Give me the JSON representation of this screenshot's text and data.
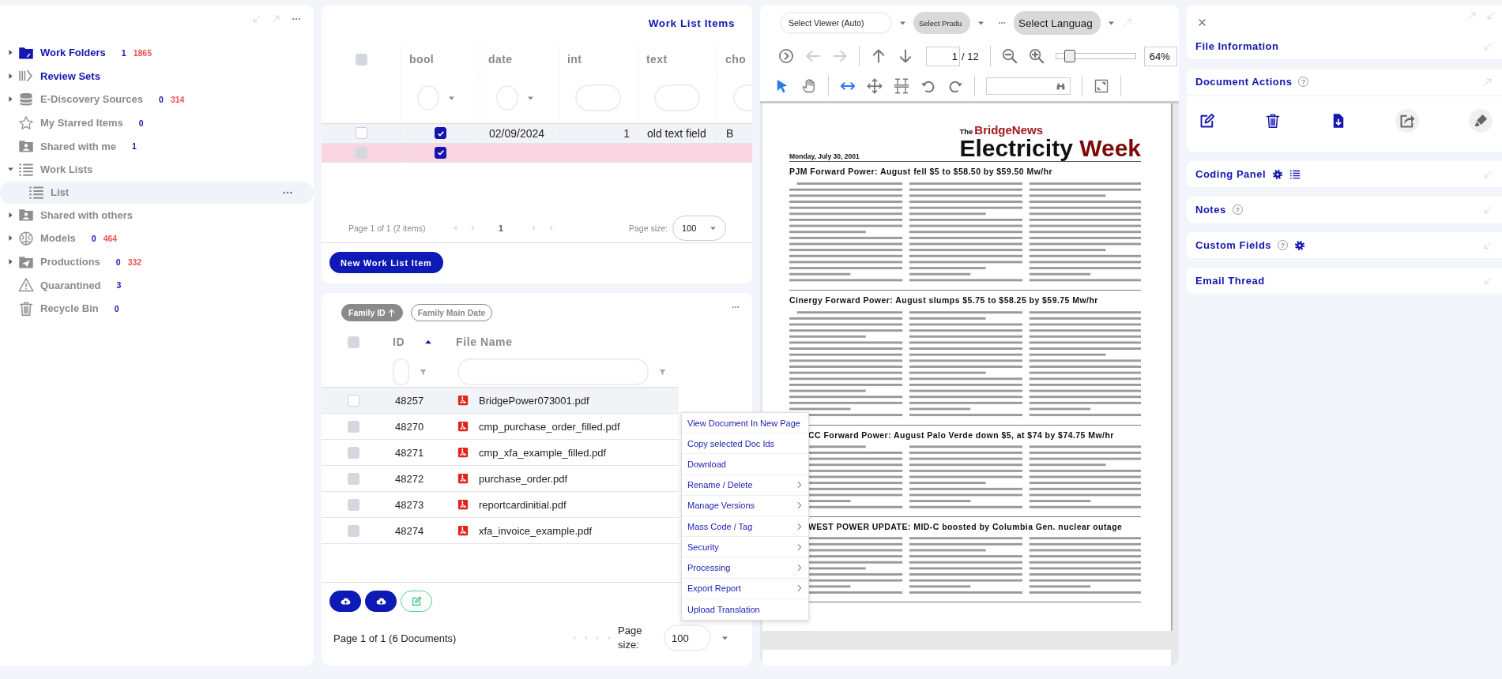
{
  "sidebar": {
    "items": [
      {
        "label": "Work Folders",
        "has_children": true,
        "expanded": false,
        "highlighted": true,
        "count": "1",
        "total": "1865"
      },
      {
        "label": "Review Sets",
        "has_children": true,
        "expanded": false,
        "highlighted": true
      },
      {
        "label": "E-Discovery Sources",
        "has_children": true,
        "expanded": false,
        "highlighted": false,
        "count": "0",
        "total": "314"
      },
      {
        "label": "My Starred Items",
        "has_children": false,
        "highlighted": false,
        "count": "0"
      },
      {
        "label": "Shared with me",
        "has_children": false,
        "highlighted": false,
        "count": "1"
      },
      {
        "label": "Work Lists",
        "has_children": true,
        "expanded": true,
        "highlighted": false,
        "children": [
          {
            "label": "List",
            "selected": true
          }
        ]
      },
      {
        "label": "Shared with others",
        "has_children": true,
        "expanded": false,
        "highlighted": false
      },
      {
        "label": "Models",
        "has_children": true,
        "expanded": false,
        "highlighted": false,
        "count": "0",
        "total": "464"
      },
      {
        "label": "Productions",
        "has_children": true,
        "expanded": false,
        "highlighted": false,
        "count": "0",
        "total": "332"
      },
      {
        "label": "Quarantined",
        "has_children": false,
        "highlighted": false,
        "count": "3"
      },
      {
        "label": "Recycle Bin",
        "has_children": false,
        "highlighted": false,
        "count": "0"
      }
    ]
  },
  "work_list": {
    "title": "Work List Items",
    "all_selected": false,
    "columns": [
      {
        "label": "bool",
        "kind": "dropdown"
      },
      {
        "label": "date",
        "kind": "dropdown"
      },
      {
        "label": "int",
        "kind": "text"
      },
      {
        "label": "text",
        "kind": "text"
      },
      {
        "label": "cho",
        "kind": "text"
      }
    ],
    "rows": [
      {
        "selected": false,
        "disabled": false,
        "flagged": false,
        "bool": true,
        "cells": [
          "02/09/2024",
          "1",
          "old text field",
          "B"
        ]
      },
      {
        "selected": false,
        "disabled": true,
        "flagged": true,
        "bool": true
      }
    ],
    "pager": {
      "summary": "Page 1 of 1 (2 items)",
      "page": "1",
      "size_label": "Page size:",
      "size": "100"
    },
    "button": "New Work List Item"
  },
  "documents": {
    "all_selected": false,
    "sort_chips": [
      {
        "label": "Family ID",
        "active": true
      },
      {
        "label": "Family Main Date",
        "active": false
      }
    ],
    "columns": [
      "ID",
      "File Name"
    ],
    "rows": [
      {
        "id": "48257",
        "name": "BridgePower073001.pdf",
        "highlighted": true,
        "selected": false
      },
      {
        "id": "48270",
        "name": "cmp_purchase_order_filled.pdf",
        "highlighted": false,
        "selected": false
      },
      {
        "id": "48271",
        "name": "cmp_xfa_example_filled.pdf",
        "highlighted": false,
        "selected": false
      },
      {
        "id": "48272",
        "name": "purchase_order.pdf",
        "highlighted": false,
        "selected": false
      },
      {
        "id": "48273",
        "name": "reportcardinitial.pdf",
        "highlighted": false,
        "selected": false
      },
      {
        "id": "48274",
        "name": "xfa_invoice_example.pdf",
        "highlighted": false,
        "selected": false
      }
    ],
    "pager": {
      "summary": "Page 1 of 1 (6 Documents)",
      "size_label": "Page size:",
      "size": "100"
    }
  },
  "context_menu": {
    "items": [
      {
        "label": "View Document In New Page",
        "submenu": false
      },
      {
        "label": "Copy selected Doc Ids",
        "submenu": false
      },
      {
        "label": "Download",
        "submenu": false
      },
      {
        "label": "Rename / Delete",
        "submenu": true
      },
      {
        "label": "Manage Versions",
        "submenu": true
      },
      {
        "label": "Mass Code / Tag",
        "submenu": true
      },
      {
        "label": "Security",
        "submenu": true
      },
      {
        "label": "Processing",
        "submenu": true
      },
      {
        "label": "Export Report",
        "submenu": true
      },
      {
        "label": "Upload Translation",
        "submenu": false
      }
    ]
  },
  "viewer": {
    "selects": [
      {
        "value": "Select Viewer (Auto)",
        "kind": "outline"
      },
      {
        "value": "Select Produ",
        "kind": "filled"
      },
      {
        "value": "Select Languag",
        "kind": "large"
      }
    ],
    "page": "1",
    "page_total": "/ 12",
    "zoom": {
      "level": 0.1,
      "reading": "64%"
    },
    "document": {
      "masthead_prefix": "The",
      "masthead_brand": "BridgeNews",
      "title": "Electricity",
      "title_accent": "Week",
      "date": "Monday, July 30, 2001",
      "articles": [
        {
          "headline": "PJM Forward Power: August fell $5 to $58.50 by $59.50 Mw/hr",
          "kind": "full"
        },
        {
          "headline": "Cinergy Forward Power: August slumps $5.75 to $58.25 by $59.75 Mw/hr",
          "kind": "full"
        },
        {
          "headline": "CC Forward Power: August Palo Verde down $5, at $74 by $74.75 Mw/hr",
          "kind": "covered"
        },
        {
          "headline": "WEST POWER UPDATE: MID-C boosted by Columbia Gen. nuclear outage",
          "kind": "covered"
        }
      ]
    }
  },
  "details": {
    "sections": [
      {
        "title": "File Information",
        "expanded": false
      },
      {
        "title": "Document Actions",
        "help": "?",
        "expanded": true
      },
      {
        "title": "Coding Panel",
        "expanded": false
      },
      {
        "title": "Notes",
        "help": "?",
        "expanded": false
      },
      {
        "title": "Custom Fields",
        "help": "?",
        "expanded": false
      },
      {
        "title": "Email Thread",
        "expanded": false
      }
    ]
  }
}
